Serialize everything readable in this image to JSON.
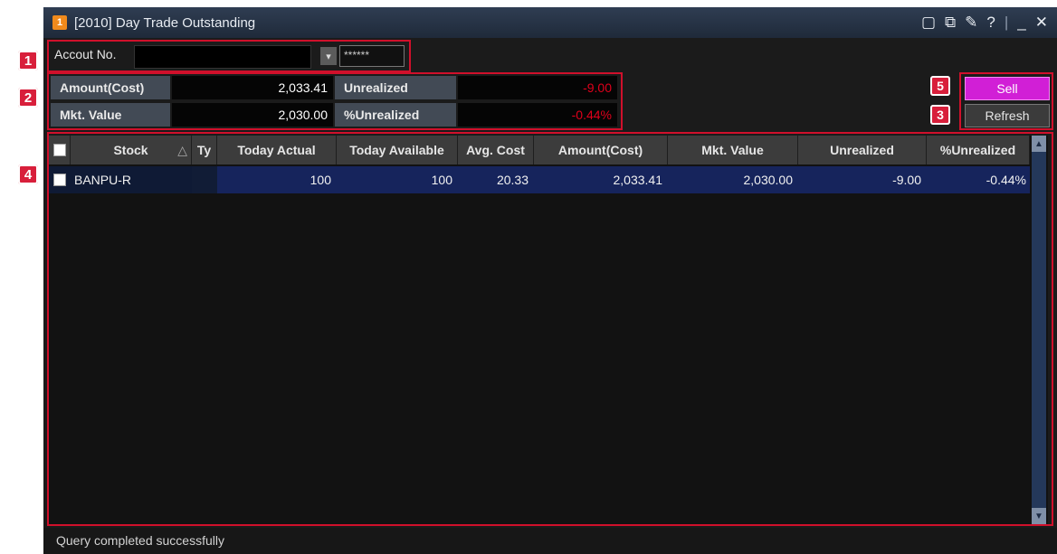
{
  "badges": [
    "1",
    "2",
    "3",
    "4",
    "5"
  ],
  "window": {
    "title": "[2010] Day Trade Outstanding",
    "icon_label": "1",
    "controls": [
      "restore-icon",
      "popout-icon",
      "pin-icon",
      "help-icon",
      "minimize-icon",
      "close-icon"
    ],
    "control_glyphs": {
      "restore": "▢",
      "popout": "⧉",
      "pin": "✎",
      "help": "?",
      "sep": "|",
      "minimize": "_",
      "close": "✕"
    }
  },
  "account": {
    "label": "Accout No.",
    "value": "",
    "password": "******"
  },
  "summary": {
    "amount_cost_label": "Amount(Cost)",
    "amount_cost_value": "2,033.41",
    "mkt_value_label": "Mkt. Value",
    "mkt_value_value": "2,030.00",
    "unrealized_label": "Unrealized",
    "unrealized_value": "-9.00",
    "pct_unrealized_label": "%Unrealized",
    "pct_unrealized_value": "-0.44%"
  },
  "buttons": {
    "sell": "Sell",
    "refresh": "Refresh"
  },
  "table": {
    "columns": [
      "Stock",
      "Ty",
      "Today Actual",
      "Today Available",
      "Avg. Cost",
      "Amount(Cost)",
      "Mkt. Value",
      "Unrealized",
      "%Unrealized"
    ],
    "sort_indicator": "△",
    "rows": [
      {
        "stock": "BANPU-R",
        "ty": "",
        "today_actual": "100",
        "today_available": "100",
        "avg_cost": "20.33",
        "amount_cost": "2,033.41",
        "mkt_value": "2,030.00",
        "unrealized": "-9.00",
        "pct_unrealized": "-0.44%"
      }
    ]
  },
  "status": "Query completed successfully",
  "colors": {
    "accent_red": "#d0102b",
    "sell_magenta": "#d11fd6",
    "negative": "#e0001b"
  }
}
